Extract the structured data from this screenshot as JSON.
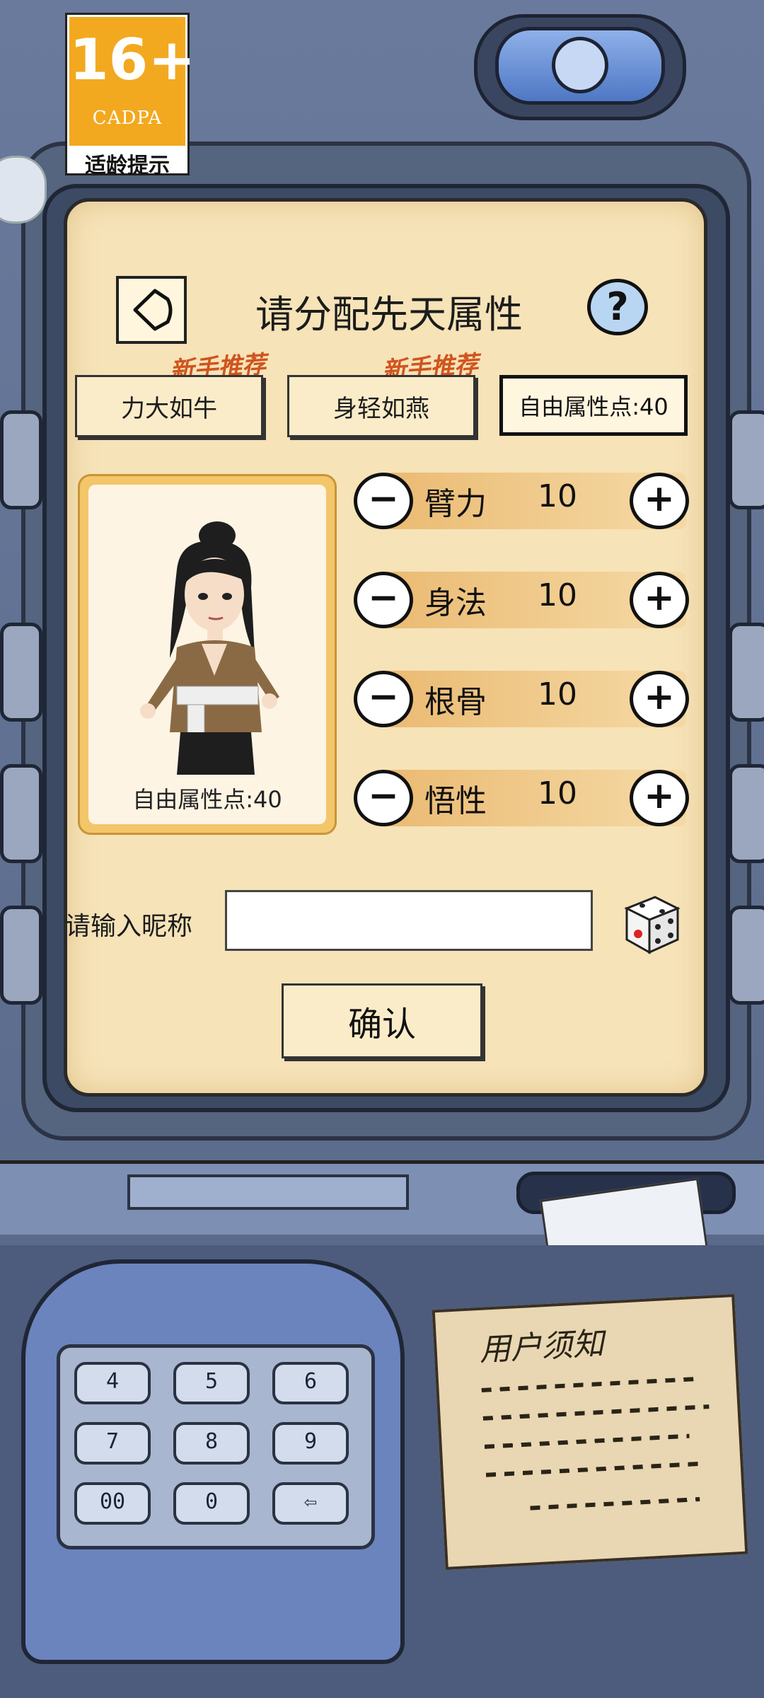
{
  "rating": {
    "age": "16+",
    "org": "CADPA",
    "caption": "适龄提示"
  },
  "header": {
    "title": "请分配先天属性",
    "help": "?"
  },
  "presets": [
    {
      "tag": "新手推荐",
      "label": "力大如牛"
    },
    {
      "tag": "新手推荐",
      "label": "身轻如燕"
    }
  ],
  "free_points": {
    "label": "自由属性点:40"
  },
  "character": {
    "points_label": "自由属性点:40"
  },
  "attributes": [
    {
      "name": "臂力",
      "value": "10"
    },
    {
      "name": "身法",
      "value": "10"
    },
    {
      "name": "根骨",
      "value": "10"
    },
    {
      "name": "悟性",
      "value": "10"
    }
  ],
  "controls": {
    "minus": "−",
    "plus": "+"
  },
  "nickname": {
    "label": "请输入昵称",
    "value": "",
    "placeholder": ""
  },
  "confirm": {
    "label": "确认"
  },
  "keypad": {
    "keys": [
      "4",
      "5",
      "6",
      "7",
      "8",
      "9",
      "00",
      "0",
      "⇦"
    ]
  },
  "notice": {
    "title": "用户须知"
  },
  "colors": {
    "screen": "#f6e3b8",
    "badge": "#f2a91f",
    "tag": "#d0541e",
    "machine": "#5b6b8c"
  }
}
